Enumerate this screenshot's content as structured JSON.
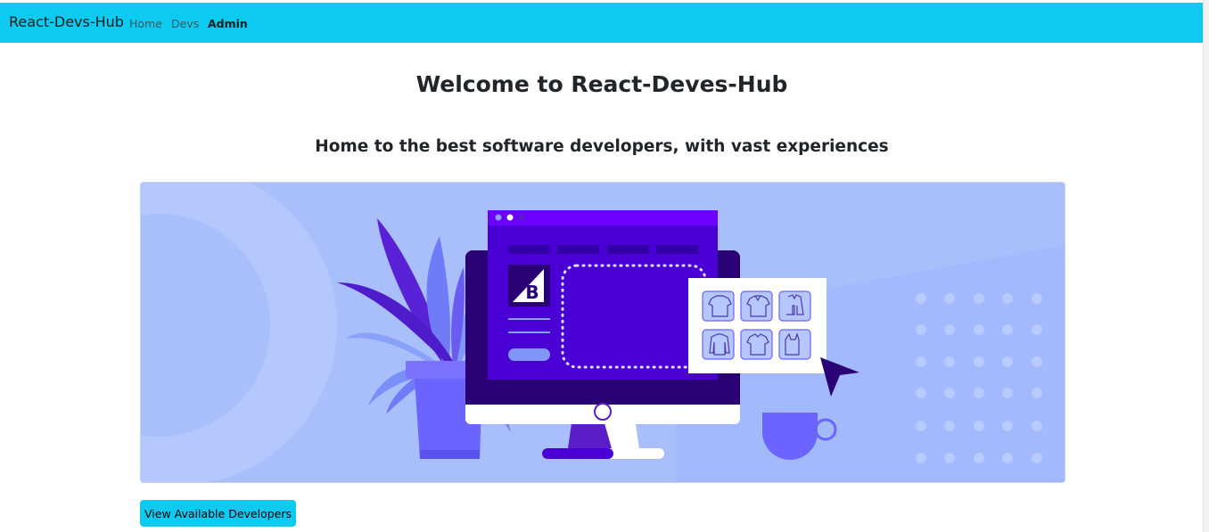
{
  "navbar": {
    "brand": "React-Devs-Hub",
    "links": [
      {
        "label": "Home",
        "active": false
      },
      {
        "label": "Devs",
        "active": false
      },
      {
        "label": "Admin",
        "active": true
      }
    ],
    "bg_color": "#0dcaf0"
  },
  "main": {
    "title": "Welcome to React-Deves-Hub",
    "subtitle": "Home to the best software developers, with vast experiences",
    "hero_image": {
      "logo_letter": "B",
      "icons": [
        "tshirt-icon",
        "polo-shirt-icon",
        "jacket-icon",
        "sweater-icon",
        "blouse-icon",
        "tank-top-icon"
      ],
      "colors": {
        "background": "#a9bffc",
        "monitor": "#4a00d4",
        "accent": "#6b64ff"
      }
    },
    "cta_label": "View Available Developers"
  }
}
